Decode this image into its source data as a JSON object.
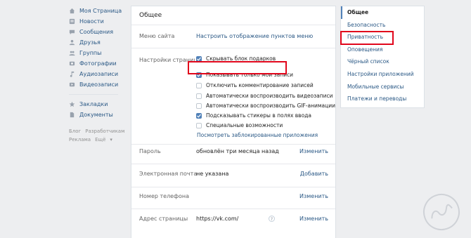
{
  "left_nav": {
    "items": [
      {
        "label": "Моя Страница",
        "icon": "home-icon"
      },
      {
        "label": "Новости",
        "icon": "news-icon"
      },
      {
        "label": "Сообщения",
        "icon": "messages-icon"
      },
      {
        "label": "Друзья",
        "icon": "friends-icon"
      },
      {
        "label": "Группы",
        "icon": "groups-icon"
      },
      {
        "label": "Фотографии",
        "icon": "photos-icon"
      },
      {
        "label": "Аудиозаписи",
        "icon": "music-icon"
      },
      {
        "label": "Видеозаписи",
        "icon": "video-icon"
      }
    ],
    "extra_items": [
      {
        "label": "Закладки",
        "icon": "star-icon"
      },
      {
        "label": "Документы",
        "icon": "document-icon"
      }
    ],
    "footer": {
      "blog": "Блог",
      "developers": "Разработчикам",
      "ads": "Реклама",
      "more": "Ещё"
    }
  },
  "main": {
    "title": "Общее",
    "site_menu": {
      "label": "Меню сайта",
      "link": "Настроить отображение пунктов меню"
    },
    "page_settings": {
      "label": "Настройки страницы",
      "options": [
        {
          "label": "Скрывать блок подарков",
          "checked": true
        },
        {
          "label": "Показывать только мои записи",
          "checked": true
        },
        {
          "label": "Отключить комментирование записей",
          "checked": false
        },
        {
          "label": "Автоматически воспроизводить видеозаписи",
          "checked": false
        },
        {
          "label": "Автоматически воспроизводить GIF-анимации",
          "checked": false
        },
        {
          "label": "Подсказывать стикеры в полях ввода",
          "checked": true
        },
        {
          "label": "Специальные возможности",
          "checked": false
        }
      ],
      "blocked_apps_link": "Посмотреть заблокированные приложения"
    },
    "password": {
      "label": "Пароль",
      "value": "обновлён три месяца назад",
      "action": "Изменить"
    },
    "email": {
      "label": "Электронная почта",
      "value": "не указана",
      "action": "Добавить"
    },
    "phone": {
      "label": "Номер телефона",
      "value": "",
      "action": "Изменить"
    },
    "address": {
      "label": "Адрес страницы",
      "value": "https://vk.com/",
      "hint": "?",
      "action": "Изменить"
    }
  },
  "right_menu": {
    "items": [
      {
        "label": "Общее",
        "active": true
      },
      {
        "label": "Безопасность",
        "active": false
      },
      {
        "label": "Приватность",
        "active": false
      },
      {
        "label": "Оповещения",
        "active": false
      },
      {
        "label": "Чёрный список",
        "active": false
      },
      {
        "label": "Настройки приложений",
        "active": false
      },
      {
        "label": "Мобильные сервисы",
        "active": false
      },
      {
        "label": "Платежи и переводы",
        "active": false
      }
    ]
  },
  "colors": {
    "link": "#2a5885",
    "accent": "#5181b8",
    "highlight": "#e1061b",
    "background": "#edeef0"
  }
}
